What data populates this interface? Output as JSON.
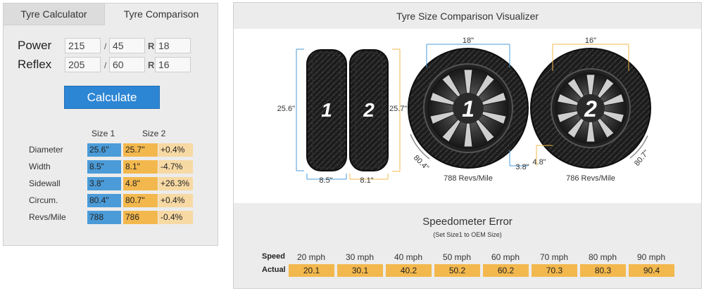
{
  "tabs": {
    "calculator": "Tyre Calculator",
    "comparison": "Tyre Comparison"
  },
  "sizes": [
    {
      "label": "Power",
      "width": "215",
      "aspect": "45",
      "rim": "18"
    },
    {
      "label": "Reflex",
      "width": "205",
      "aspect": "60",
      "rim": "16"
    }
  ],
  "separators": {
    "slash": "/",
    "r": "R"
  },
  "calculate_label": "Calculate",
  "results": {
    "headers": {
      "size1": "Size 1",
      "size2": "Size 2"
    },
    "rows": [
      {
        "label": "Diameter",
        "s1": "25.6\"",
        "s2": "25.7\"",
        "diff": "+0.4%"
      },
      {
        "label": "Width",
        "s1": "8.5\"",
        "s2": "8.1\"",
        "diff": "-4.7%"
      },
      {
        "label": "Sidewall",
        "s1": "3.8\"",
        "s2": "4.8\"",
        "diff": "+26.3%"
      },
      {
        "label": "Circum.",
        "s1": "80.4\"",
        "s2": "80.7\"",
        "diff": "+0.4%"
      },
      {
        "label": "Revs/Mile",
        "s1": "788",
        "s2": "786",
        "diff": "-0.4%"
      }
    ]
  },
  "visualizer": {
    "title": "Tyre Size Comparison Visualizer",
    "side": {
      "diameter1": "25.6\"",
      "diameter2": "25.7\"",
      "width1": "8.5\"",
      "width2": "8.1\"",
      "num1": "1",
      "num2": "2"
    },
    "front": {
      "rim1": "18\"",
      "rim2": "16\"",
      "circum1": "80.4\"",
      "circum2": "80.7\"",
      "sidewall1": "3.8\"",
      "sidewall2": "4.8\"",
      "revs1": "788 Revs/Mile",
      "revs2": "786 Revs/Mile",
      "num1": "1",
      "num2": "2"
    },
    "colors": {
      "size1_line": "#4b9bd8",
      "size2_line": "#f3b84d"
    }
  },
  "speedo": {
    "title": "Speedometer Error",
    "subtitle": "(Set Size1 to OEM Size)",
    "speed_label": "Speed",
    "actual_label": "Actual",
    "speeds": [
      "20 mph",
      "30 mph",
      "40 mph",
      "50 mph",
      "60 mph",
      "70 mph",
      "80 mph",
      "90 mph"
    ],
    "actuals": [
      "20.1",
      "30.1",
      "40.2",
      "50.2",
      "60.2",
      "70.3",
      "80.3",
      "90.4"
    ]
  }
}
